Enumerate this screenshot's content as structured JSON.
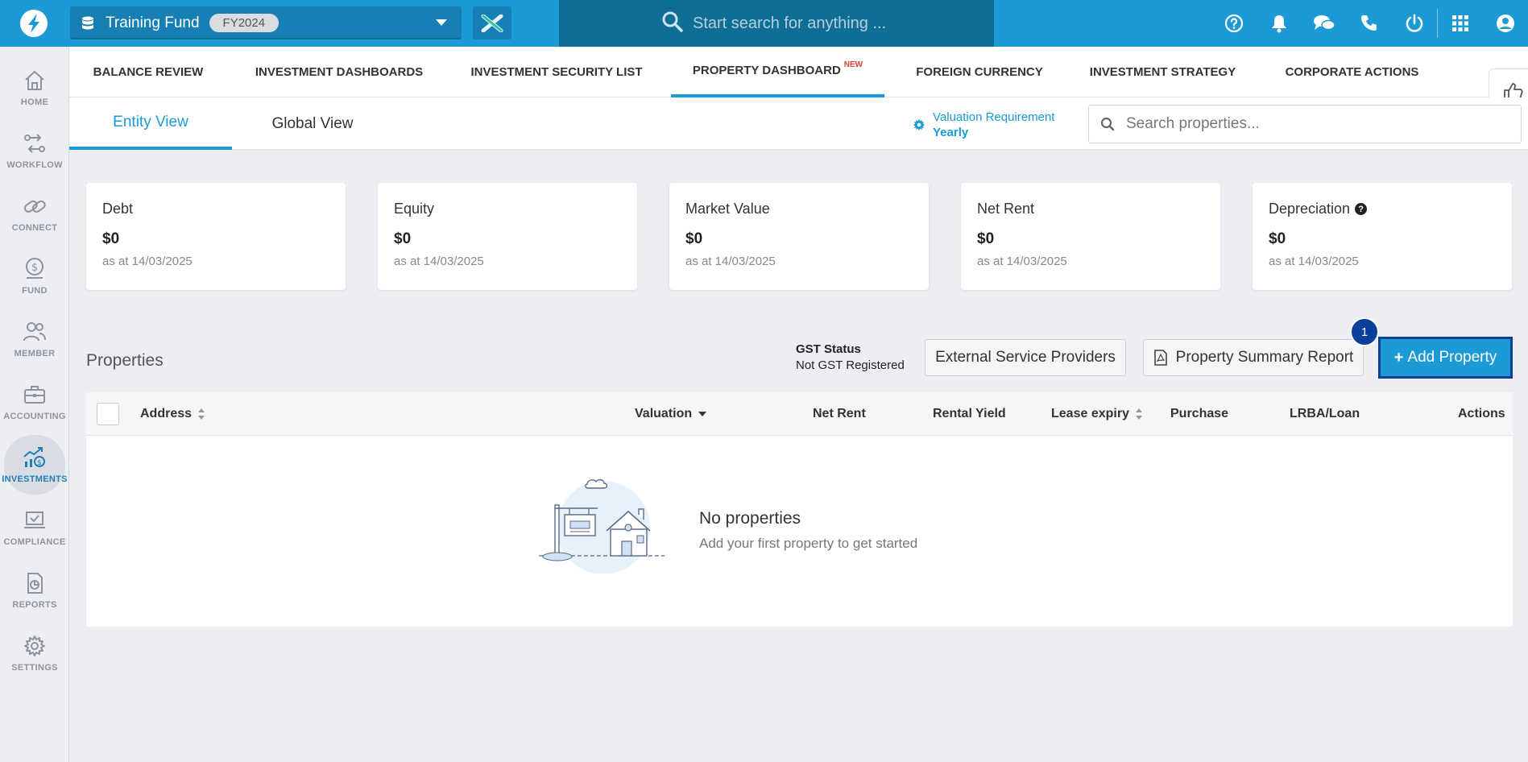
{
  "topbar": {
    "logo_icon": "app-logo-icon",
    "fund_name": "Training Fund",
    "fund_year": "FY2024",
    "search_placeholder": "Start search for anything ...",
    "icons": [
      "help-icon",
      "bell-icon",
      "chat-icon",
      "phone-icon",
      "power-icon",
      "apps-grid-icon",
      "user-icon"
    ]
  },
  "sidebar": {
    "items": [
      {
        "label": "HOME",
        "icon": "home-icon"
      },
      {
        "label": "WORKFLOW",
        "icon": "workflow-icon"
      },
      {
        "label": "CONNECT",
        "icon": "link-icon"
      },
      {
        "label": "FUND",
        "icon": "dollar-coin-icon"
      },
      {
        "label": "MEMBER",
        "icon": "members-icon"
      },
      {
        "label": "ACCOUNTING",
        "icon": "briefcase-icon"
      },
      {
        "label": "INVESTMENTS",
        "icon": "investments-icon"
      },
      {
        "label": "COMPLIANCE",
        "icon": "laptop-check-icon"
      },
      {
        "label": "REPORTS",
        "icon": "report-icon"
      },
      {
        "label": "SETTINGS",
        "icon": "gear-icon"
      }
    ],
    "active": "INVESTMENTS"
  },
  "main_nav": {
    "tabs": [
      {
        "label": "BALANCE REVIEW"
      },
      {
        "label": "INVESTMENT DASHBOARDS"
      },
      {
        "label": "INVESTMENT SECURITY LIST"
      },
      {
        "label": "PROPERTY DASHBOARD",
        "badge": "NEW"
      },
      {
        "label": "FOREIGN CURRENCY"
      },
      {
        "label": "INVESTMENT STRATEGY"
      },
      {
        "label": "CORPORATE ACTIONS"
      }
    ],
    "active": "PROPERTY DASHBOARD"
  },
  "sub_nav": {
    "tabs": [
      {
        "label": "Entity View"
      },
      {
        "label": "Global View"
      }
    ],
    "active": "Entity View",
    "valuation_label": "Valuation Requirement",
    "valuation_value": "Yearly",
    "search_placeholder": "Search properties..."
  },
  "cards": [
    {
      "title": "Debt",
      "value": "$0",
      "date": "as at 14/03/2025"
    },
    {
      "title": "Equity",
      "value": "$0",
      "date": "as at 14/03/2025"
    },
    {
      "title": "Market Value",
      "value": "$0",
      "date": "as at 14/03/2025"
    },
    {
      "title": "Net Rent",
      "value": "$0",
      "date": "as at 14/03/2025"
    },
    {
      "title": "Depreciation",
      "value": "$0",
      "date": "as at 14/03/2025",
      "help": "?"
    }
  ],
  "properties": {
    "heading": "Properties",
    "gst_title": "GST Status",
    "gst_value": "Not GST Registered",
    "external_providers_label": "External Service Providers",
    "summary_report_label": "Property Summary Report",
    "add_label": "Add Property",
    "step_number": "1",
    "columns": [
      "Address",
      "Valuation",
      "Net Rent",
      "Rental Yield",
      "Lease expiry",
      "Purchase",
      "LRBA/Loan",
      "Actions"
    ],
    "empty_title": "No properties",
    "empty_subtitle": "Add your first property to get started"
  },
  "colors": {
    "brand": "#1c9ad6",
    "search_bg": "#0f6e96",
    "accent_dark": "#0b3f9c"
  }
}
